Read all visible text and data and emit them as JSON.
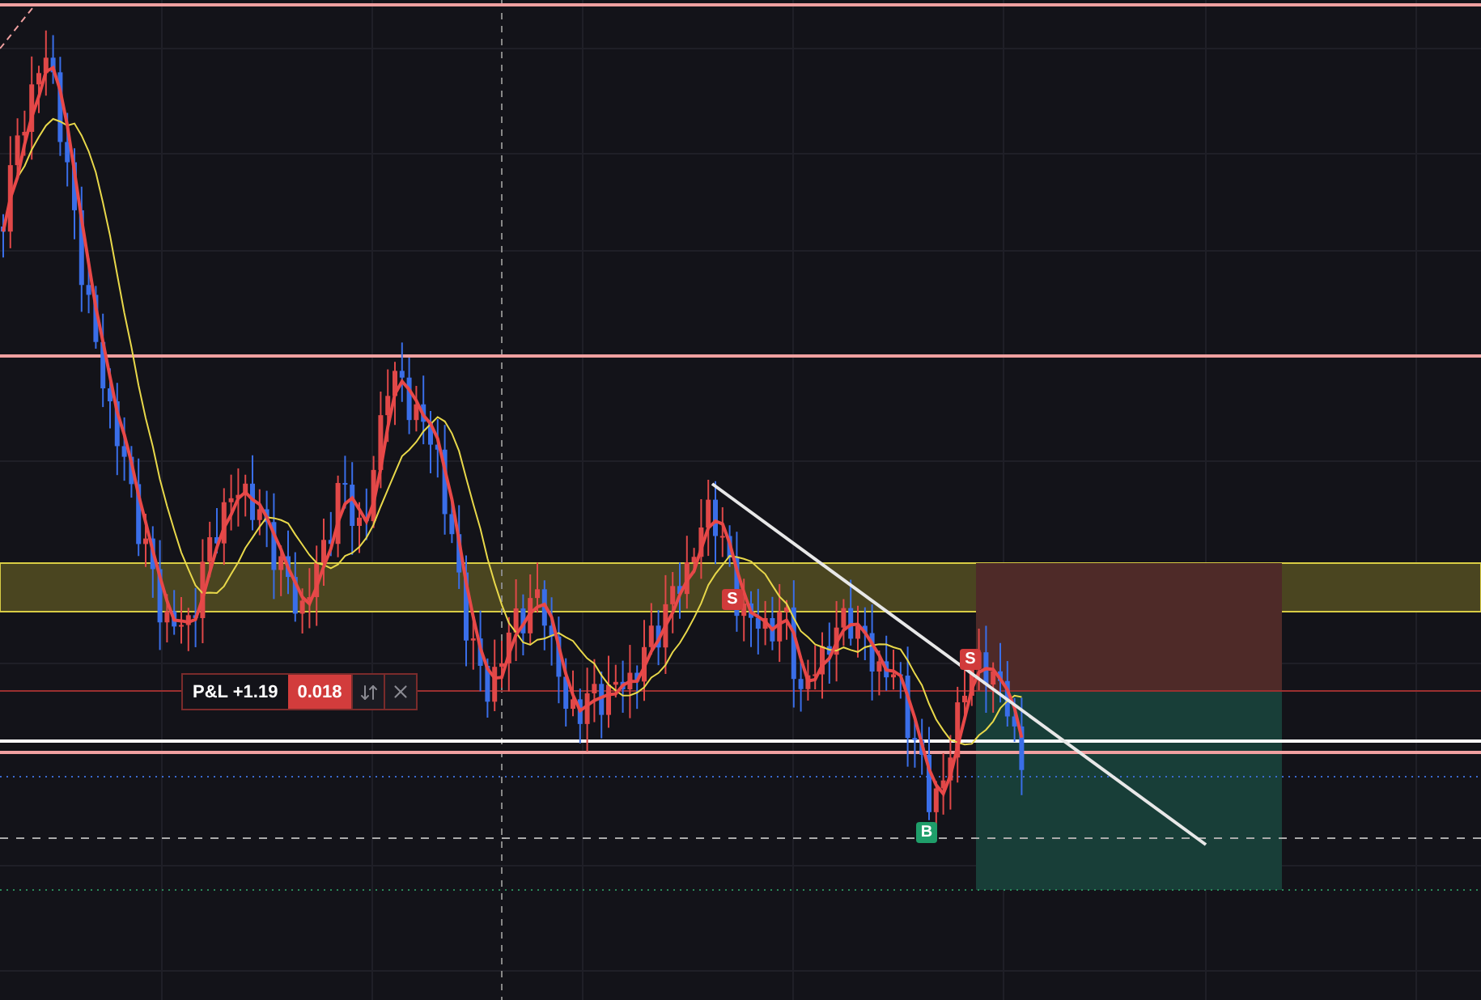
{
  "position": {
    "pnl": "P&L +1.19",
    "quantity": "0.018"
  },
  "markers": [
    {
      "kind": "sell",
      "label": "S"
    },
    {
      "kind": "sell",
      "label": "S"
    },
    {
      "kind": "buy",
      "label": "B"
    }
  ]
}
